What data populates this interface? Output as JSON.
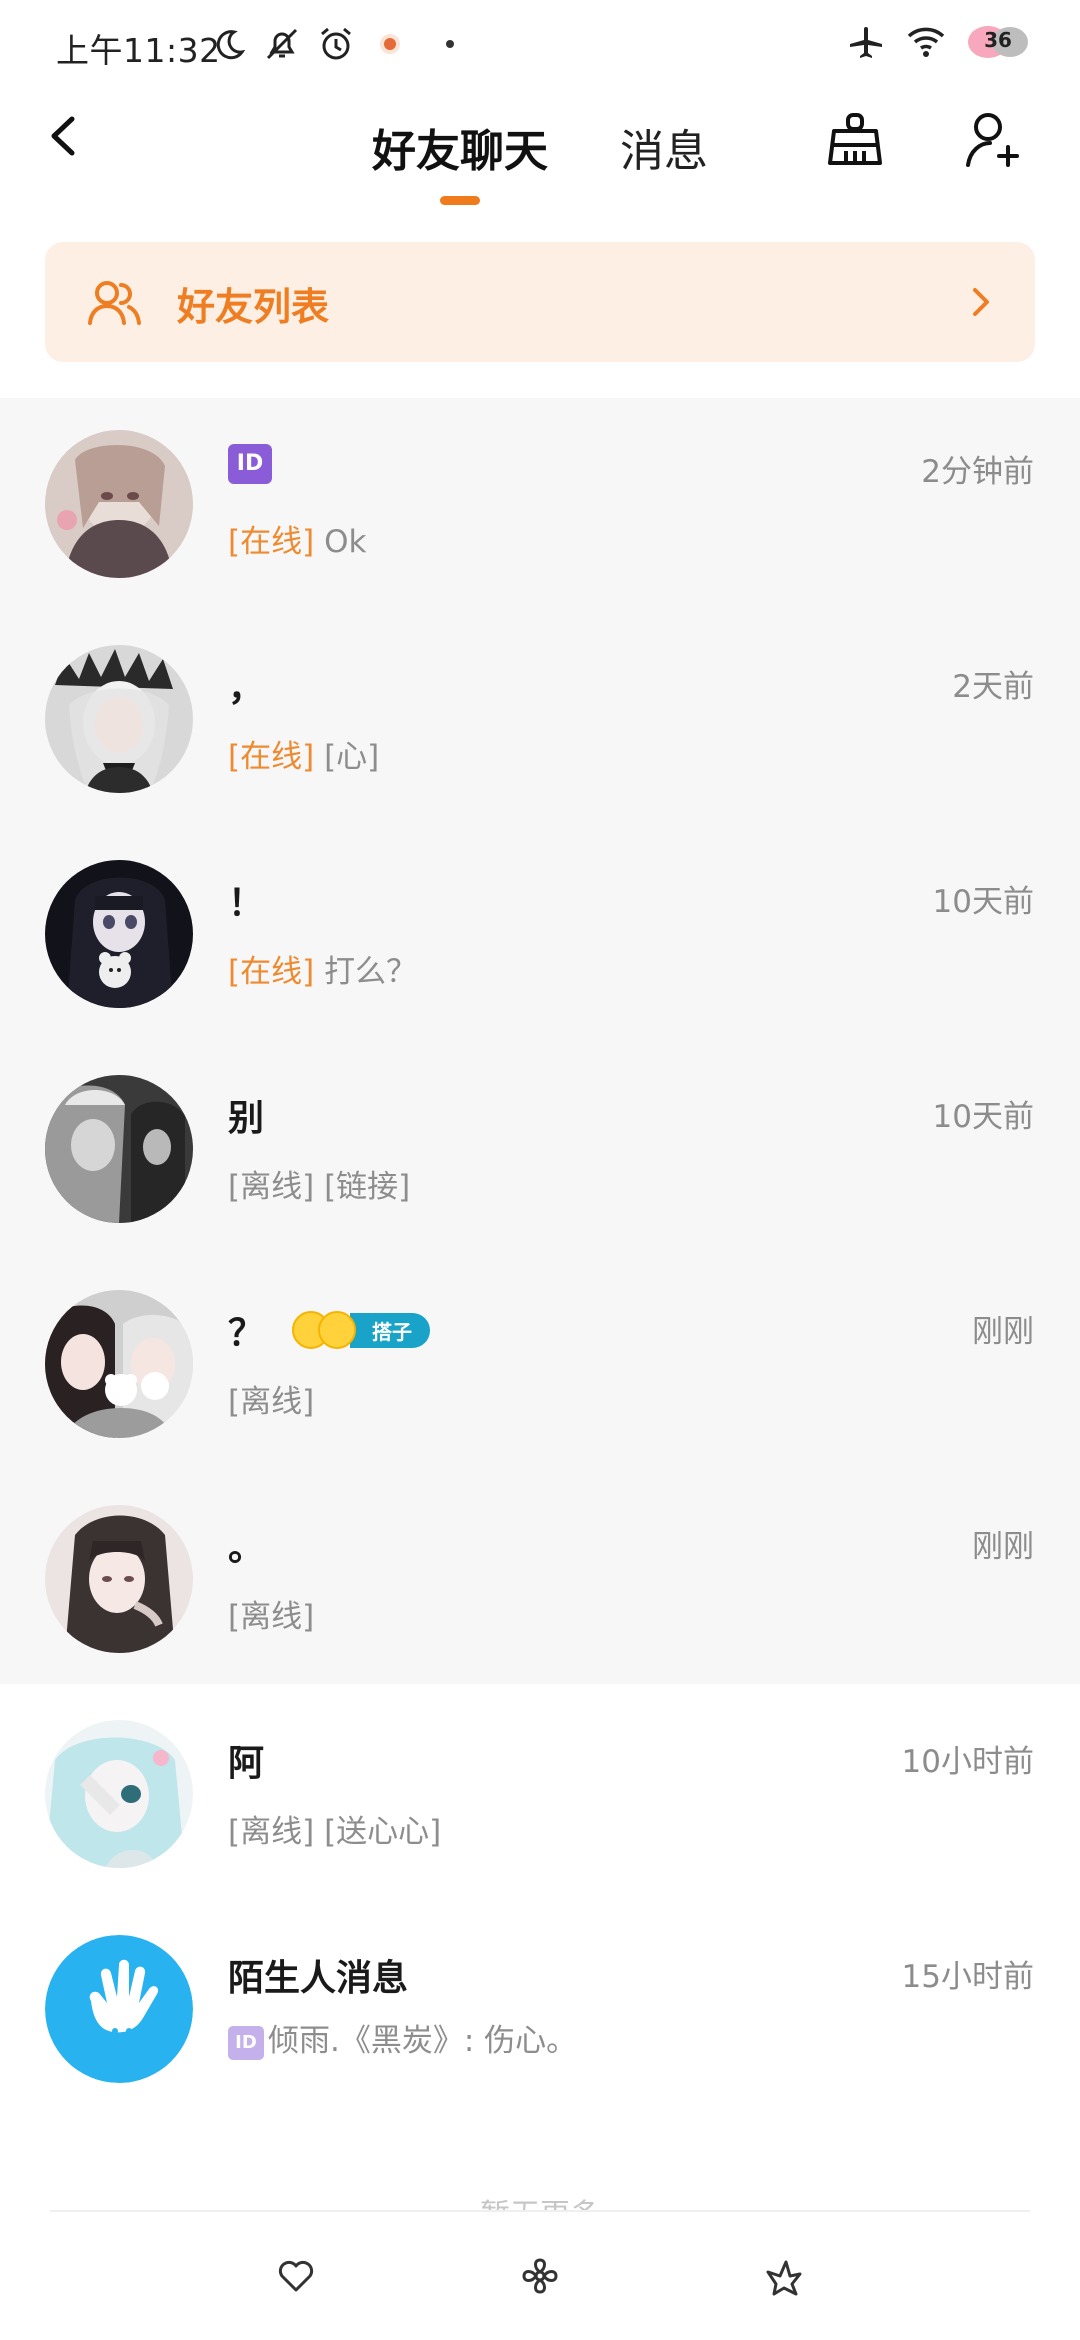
{
  "status_bar": {
    "time": "上午11:32",
    "battery": "36",
    "icons": [
      "moon-icon",
      "mute-icon",
      "alarm-icon",
      "app-notification-icon",
      "airplane-icon",
      "wifi-icon",
      "battery-icon"
    ]
  },
  "header": {
    "tabs": [
      {
        "label": "好友聊天",
        "active": true
      },
      {
        "label": "消息",
        "active": false
      }
    ],
    "accent_color": "#f07b1c"
  },
  "friends_banner": {
    "label": "好友列表"
  },
  "chats": [
    {
      "name": "ID",
      "name_is_badge": true,
      "time": "2分钟前",
      "status": "[在线]",
      "online": true,
      "message": "Ok"
    },
    {
      "name": "，",
      "time": "2天前",
      "status": "[在线]",
      "online": true,
      "message": "[心]"
    },
    {
      "name": "！",
      "time": "10天前",
      "status": "[在线]",
      "online": true,
      "message": "打么？"
    },
    {
      "name": "别",
      "time": "10天前",
      "status": "[离线]",
      "online": false,
      "message": "[链接]"
    },
    {
      "name": "？",
      "time": "刚刚",
      "status": "[离线]",
      "online": false,
      "message": "",
      "tag": "搭子"
    },
    {
      "name": "。",
      "time": "刚刚",
      "status": "[离线]",
      "online": false,
      "message": ""
    },
    {
      "name": "阿",
      "time": "10小时前",
      "status": "[离线]",
      "online": false,
      "message": "[送心心]"
    }
  ],
  "stranger": {
    "name": "陌生人消息",
    "time": "15小时前",
    "badge": "ID",
    "message": "倾雨.《黑炭》: 伤心。"
  },
  "footer": {
    "no_more": "暂无更多"
  },
  "bottom_nav": [
    "heart-icon",
    "flower-icon",
    "bird-icon"
  ]
}
